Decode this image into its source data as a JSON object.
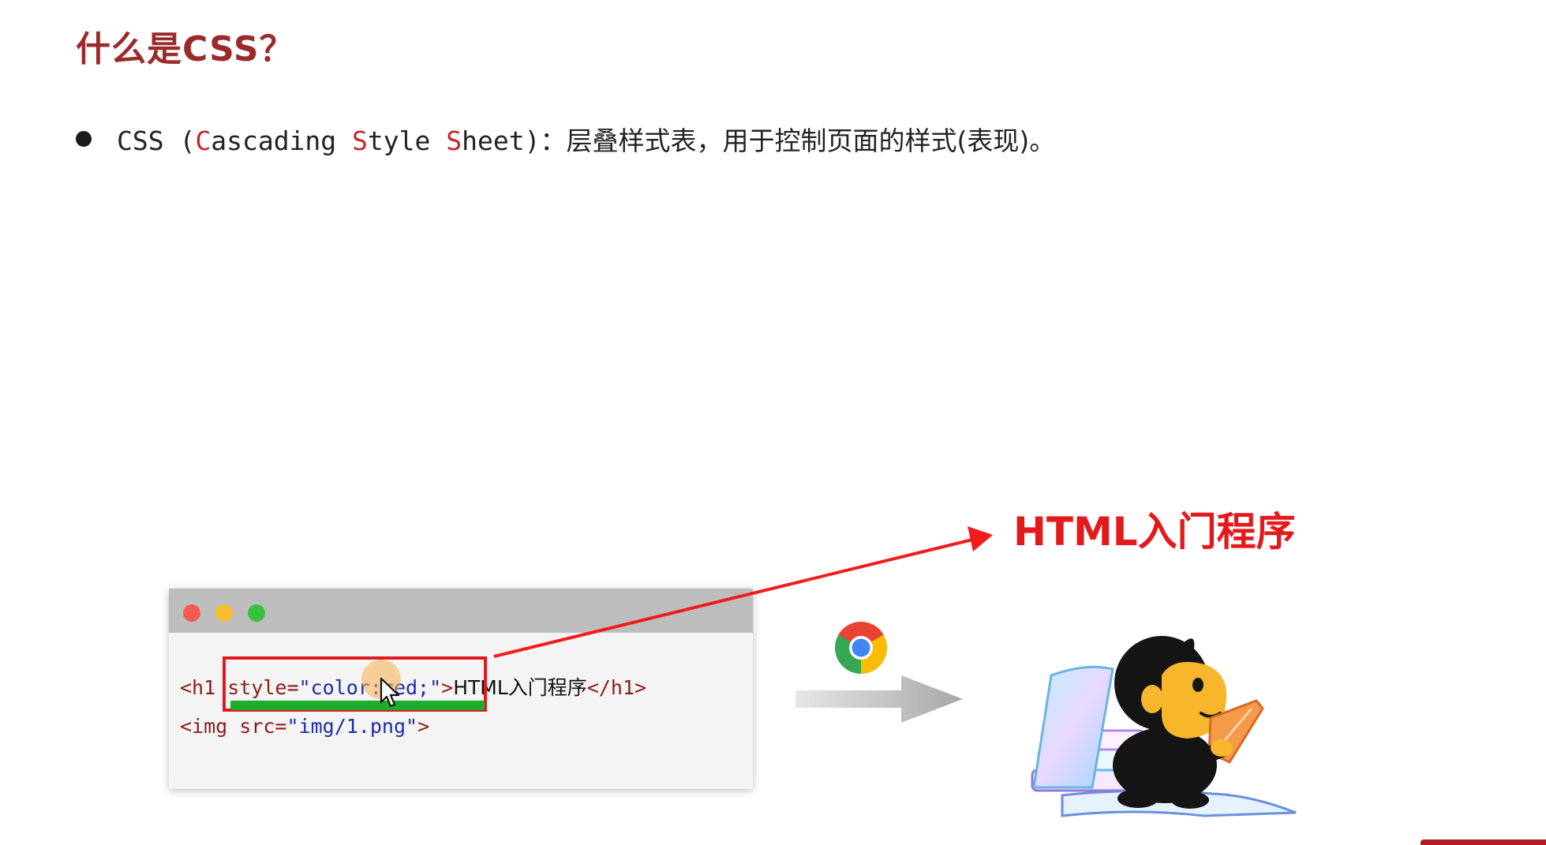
{
  "slide": {
    "title": "什么是CSS？",
    "bullet": {
      "prefix": "CSS (",
      "c_letter": "C",
      "c_rest": "ascading ",
      "s1_letter": "S",
      "s1_rest": "tyle ",
      "s2_letter": "S",
      "s2_rest": "heet",
      "suffix_paren": ")",
      "suffix": "：层叠样式表，用于控制页面的样式(表现)。"
    }
  },
  "code_window": {
    "line1": {
      "tag_open": "<h1 ",
      "attr_name": "style",
      "eq": "=",
      "attr_value": "\"color:red;\"",
      "gt": ">",
      "text": "HTML入门程序",
      "tag_close": "</h1>"
    },
    "line2": {
      "tag_open": "<img ",
      "attr_name": "src",
      "eq": "=",
      "attr_value": "\"img/1.png\"",
      "gt": ">"
    }
  },
  "result": {
    "text": "HTML入门程序",
    "color": "#e31a1c"
  },
  "icons": {
    "browser": "chrome-icon",
    "cursor": "mouse-pointer-icon",
    "mascot": "monkey-reading-illustration"
  },
  "colors": {
    "title": "#9b2b2b",
    "highlight_letter": "#c0282a",
    "highlight_box": "#e0191e",
    "underline": "#1bad2b"
  }
}
